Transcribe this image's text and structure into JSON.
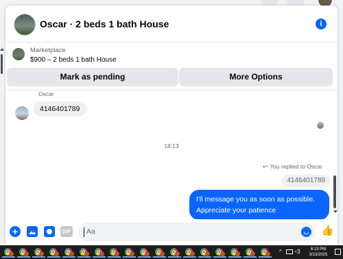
{
  "conversation": {
    "title": "Oscar · 2 beds 1 bath House",
    "info_icon": "info-icon"
  },
  "listing": {
    "kicker": "Marketplace",
    "price_title": "$900 – 2 beds 1 bath House"
  },
  "actions": {
    "mark_pending": "Mark as pending",
    "more_options": "More Options"
  },
  "thread": {
    "sender_name": "Oscar",
    "incoming_message": "4146401789",
    "timestamp": "18:13",
    "reply_context": "You replied to Oscar",
    "quoted_message": "4146401789",
    "outgoing_message": "I'll message you as soon as possible. Appreciate your patience"
  },
  "composer": {
    "placeholder": "Aa",
    "gif_label": "GIF",
    "icons": [
      "plus-icon",
      "photo-icon",
      "sticker-icon",
      "gif-icon",
      "emoji-icon",
      "like-icon"
    ]
  },
  "taskbar": {
    "time": "6:13 PM",
    "date": "3/13/2025",
    "app_icon": "chrome-icon"
  },
  "colors": {
    "accent": "#0866ff",
    "bubble_incoming": "#f0f0f0",
    "button_bg": "#e4e6eb",
    "taskbar_bg": "#1c1c1c"
  }
}
